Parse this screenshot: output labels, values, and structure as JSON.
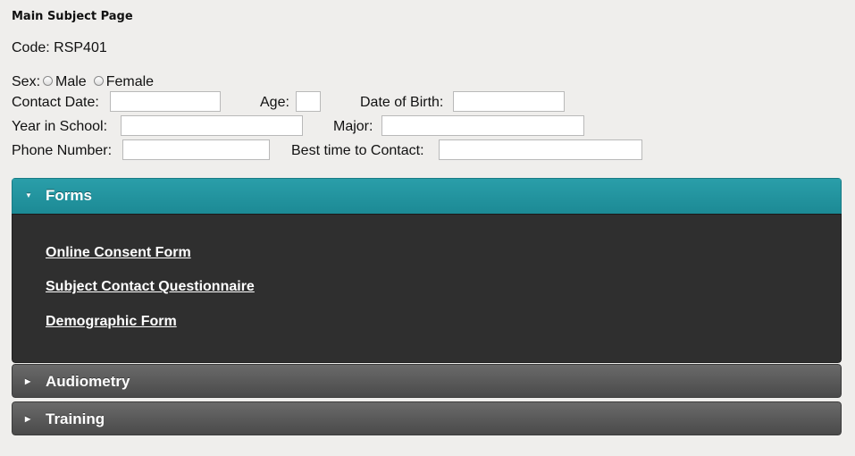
{
  "page": {
    "title": "Main Subject Page",
    "code_label": "Code: RSP401"
  },
  "form": {
    "sex_label": "Sex:",
    "sex_options": [
      "Male",
      "Female"
    ],
    "contact_date_label": "Contact Date:",
    "contact_date_value": "",
    "age_label": "Age:",
    "age_value": "",
    "dob_label": "Date of Birth:",
    "dob_value": "",
    "year_label": "Year in School:",
    "year_value": "",
    "major_label": "Major:",
    "major_value": "",
    "phone_label": "Phone Number:",
    "phone_value": "",
    "best_time_label": "Best time to Contact:",
    "best_time_value": ""
  },
  "accordion": {
    "forms": {
      "title": "Forms",
      "expanded": true,
      "links": [
        "Online Consent Form",
        "Subject Contact Questionnaire",
        "Demographic Form"
      ]
    },
    "audiometry": {
      "title": "Audiometry",
      "expanded": false
    },
    "training": {
      "title": "Training",
      "expanded": false
    }
  },
  "icons": {
    "expanded": "triangle-down-icon",
    "collapsed": "triangle-right-icon"
  },
  "colors": {
    "accent": "#1f939e",
    "panel_dark": "#2f2f2f",
    "collapsed_header": "#555555",
    "background": "#efeeec"
  }
}
